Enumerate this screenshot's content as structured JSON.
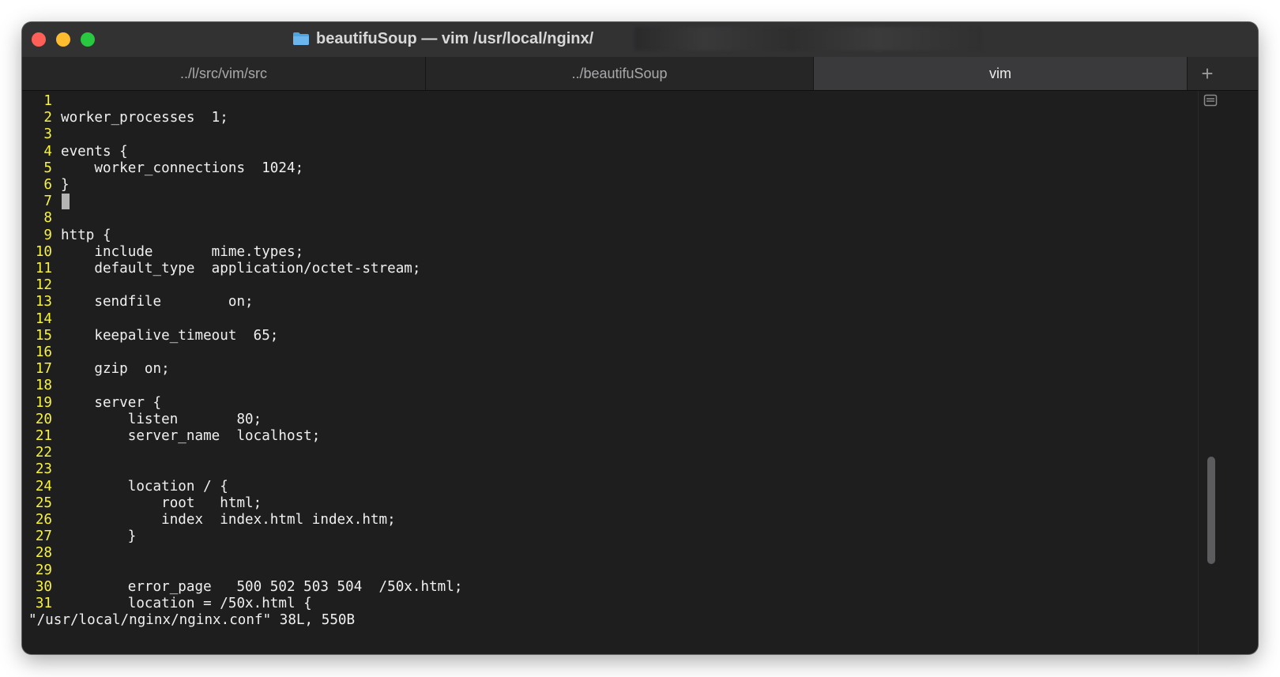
{
  "window": {
    "title": "beautifuSoup — vim /usr/local/nginx/"
  },
  "tabs": [
    {
      "label": "../l/src/vim/src",
      "active": false
    },
    {
      "label": "../beautifuSoup",
      "active": false
    },
    {
      "label": "vim",
      "active": true
    }
  ],
  "new_tab_label": "+",
  "editor": {
    "lines": [
      {
        "n": "1",
        "text": ""
      },
      {
        "n": "2",
        "text": "worker_processes  1;"
      },
      {
        "n": "3",
        "text": ""
      },
      {
        "n": "4",
        "text": "events {"
      },
      {
        "n": "5",
        "text": "    worker_connections  1024;"
      },
      {
        "n": "6",
        "text": "}"
      },
      {
        "n": "7",
        "text": ""
      },
      {
        "n": "8",
        "text": ""
      },
      {
        "n": "9",
        "text": "http {"
      },
      {
        "n": "10",
        "text": "    include       mime.types;"
      },
      {
        "n": "11",
        "text": "    default_type  application/octet-stream;"
      },
      {
        "n": "12",
        "text": ""
      },
      {
        "n": "13",
        "text": "    sendfile        on;"
      },
      {
        "n": "14",
        "text": ""
      },
      {
        "n": "15",
        "text": "    keepalive_timeout  65;"
      },
      {
        "n": "16",
        "text": ""
      },
      {
        "n": "17",
        "text": "    gzip  on;"
      },
      {
        "n": "18",
        "text": ""
      },
      {
        "n": "19",
        "text": "    server {"
      },
      {
        "n": "20",
        "text": "        listen       80;"
      },
      {
        "n": "21",
        "text": "        server_name  localhost;"
      },
      {
        "n": "22",
        "text": ""
      },
      {
        "n": "23",
        "text": ""
      },
      {
        "n": "24",
        "text": "        location / {"
      },
      {
        "n": "25",
        "text": "            root   html;"
      },
      {
        "n": "26",
        "text": "            index  index.html index.htm;"
      },
      {
        "n": "27",
        "text": "        }"
      },
      {
        "n": "28",
        "text": ""
      },
      {
        "n": "29",
        "text": ""
      },
      {
        "n": "30",
        "text": "        error_page   500 502 503 504  /50x.html;"
      },
      {
        "n": "31",
        "text": "        location = /50x.html {"
      }
    ],
    "cursor_line": 7,
    "status": "\"/usr/local/nginx/nginx.conf\" 38L, 550B"
  },
  "scrollbar": {
    "position_fraction": 0.8,
    "visible_fraction": 0.2
  },
  "colors": {
    "line_number": "#f8f43a",
    "text": "#f0f0f0",
    "background": "#1e1e1e"
  }
}
